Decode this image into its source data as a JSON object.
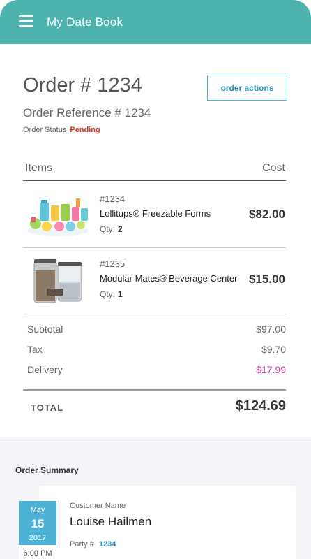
{
  "app": {
    "title": "My Date Book"
  },
  "order": {
    "title": "Order # 1234",
    "reference": "Order Reference # 1234",
    "status_label": "Order Status",
    "status_value": "Pending",
    "actions_label": "order actions"
  },
  "table": {
    "items_header": "Items",
    "cost_header": "Cost"
  },
  "items": [
    {
      "sku": "#1234",
      "name": "Lollitups® Freezable Forms",
      "qty_label": "Qty:",
      "qty": "2",
      "price": "$82.00"
    },
    {
      "sku": "#1235",
      "name": "Modular Mates® Beverage Center",
      "qty_label": "Qty:",
      "qty": "1",
      "price": "$15.00"
    }
  ],
  "totals": {
    "subtotal_label": "Subtotal",
    "subtotal": "$97.00",
    "tax_label": "Tax",
    "tax": "$9.70",
    "delivery_label": "Delivery",
    "delivery": "$17.99",
    "total_label": "TOTAL",
    "total": "$124.69"
  },
  "summary": {
    "title": "Order Summary",
    "customer_label": "Customer Name",
    "customer_name": "Louise Hailmen",
    "party_label": "Party #",
    "party_value": "1234",
    "date_month": "May",
    "date_day": "15",
    "date_year": "2017",
    "time": "6:00 PM"
  },
  "colors": {
    "appbar": "#4fb3ad",
    "accent_blue": "#4db3d6",
    "status_pending": "#e0362c",
    "delivery_magenta": "#c93aa0"
  },
  "icons": {
    "menu": "hamburger-menu-icon"
  }
}
